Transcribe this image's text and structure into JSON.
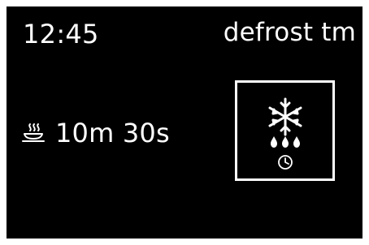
{
  "status_bar": {
    "time": "12:45",
    "mode_label": "defrost tm"
  },
  "cooking": {
    "duration_icon": "dish-steam-icon",
    "duration": "10m 30s"
  },
  "mode_tile": {
    "icon": "snowflake-icon",
    "secondary_icon": "water-drops-icon",
    "timer_icon": "clock-icon"
  },
  "colors": {
    "background": "#000000",
    "foreground": "#ffffff"
  }
}
